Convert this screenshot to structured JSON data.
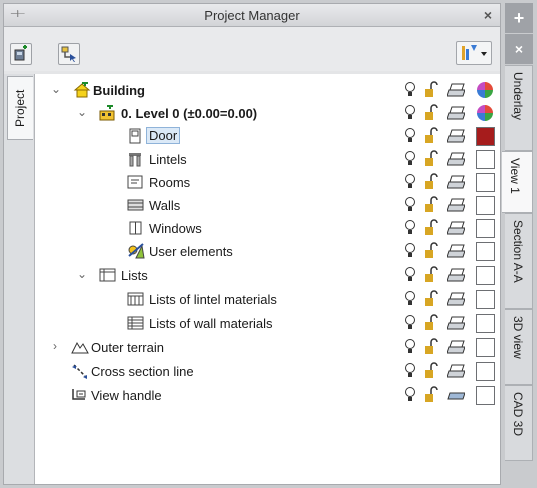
{
  "window": {
    "title": "Project Manager",
    "pin_glyph": "⊣⊢",
    "close_glyph": "×"
  },
  "left_tabs": [
    {
      "label": "Project"
    }
  ],
  "right_tabs": {
    "plus_glyph": "+",
    "close_glyph": "×",
    "items": [
      {
        "label": "Underlay"
      },
      {
        "label": "View 1"
      },
      {
        "label": "Section A-A"
      },
      {
        "label": "3D view"
      },
      {
        "label": "CAD 3D"
      }
    ]
  },
  "tree": [
    {
      "label": "Building",
      "expander": "⌄",
      "swatch": "multi"
    },
    {
      "label": "0. Level 0 (±0.00=0.00)",
      "expander": "⌄",
      "swatch": "multi"
    },
    {
      "label": "Door",
      "expander": "",
      "swatch": "#a61c1c"
    },
    {
      "label": "Lintels",
      "expander": "",
      "swatch": "#ffffff"
    },
    {
      "label": "Rooms",
      "expander": "",
      "swatch": "#ffffff"
    },
    {
      "label": "Walls",
      "expander": "",
      "swatch": "#ffffff"
    },
    {
      "label": "Windows",
      "expander": "",
      "swatch": "#ffffff"
    },
    {
      "label": "User elements",
      "expander": "",
      "swatch": "#ffffff"
    },
    {
      "label": "Lists",
      "expander": "⌄",
      "swatch": "#ffffff"
    },
    {
      "label": "Lists of lintel materials",
      "expander": "",
      "swatch": "#ffffff"
    },
    {
      "label": "Lists of wall materials",
      "expander": "",
      "swatch": "#ffffff"
    },
    {
      "label": "Outer terrain",
      "expander": "›",
      "swatch": "#ffffff"
    },
    {
      "label": "Cross section line",
      "expander": "",
      "swatch": "#ffffff"
    },
    {
      "label": "View handle",
      "expander": "",
      "swatch": "#ffffff"
    }
  ],
  "colors": {
    "selection_bg": "#dbe9f7",
    "door_swatch": "#a61c1c",
    "bulb_yellow": "#f2c51a",
    "lock_gold": "#d8a623",
    "building_icon": "#f5d21b"
  },
  "icons": {
    "toolbar": [
      "add-project-icon",
      "select-element-icon",
      "filter-icon"
    ],
    "columns": [
      "visibility-bulb-icon",
      "lock-icon",
      "print-icon",
      "color-swatch"
    ]
  }
}
